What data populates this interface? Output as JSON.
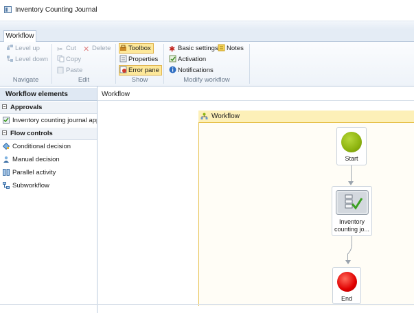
{
  "window": {
    "title": "Inventory Counting Journal"
  },
  "ribbon": {
    "tab": "Workflow",
    "navigate": {
      "label": "Navigate",
      "level_up": "Level up",
      "level_down": "Level down"
    },
    "edit": {
      "label": "Edit",
      "cut": "Cut",
      "delete": "Delete",
      "copy": "Copy",
      "paste": "Paste"
    },
    "show": {
      "label": "Show",
      "toolbox": "Toolbox",
      "properties": "Properties",
      "error_pane": "Error pane"
    },
    "modify": {
      "label": "Modify workflow",
      "basic_settings": "Basic settings",
      "notes": "Notes",
      "activation": "Activation",
      "notifications": "Notifications"
    }
  },
  "left_panel": {
    "header": "Workflow elements",
    "sections": [
      {
        "title": "Approvals",
        "items": [
          "Inventory counting journal appr"
        ]
      },
      {
        "title": "Flow controls",
        "items": [
          "Conditional decision",
          "Manual decision",
          "Parallel activity",
          "Subworkflow"
        ]
      }
    ]
  },
  "workflow": {
    "header": "Workflow",
    "container_title": "Workflow",
    "nodes": {
      "start": "Start",
      "approval_line1": "Inventory",
      "approval_line2": "counting jo...",
      "end": "End"
    }
  },
  "colors": {
    "start": "#8db30f",
    "end": "#e00000",
    "highlight": "#fde89a",
    "container_bar": "#fdf0b8"
  }
}
